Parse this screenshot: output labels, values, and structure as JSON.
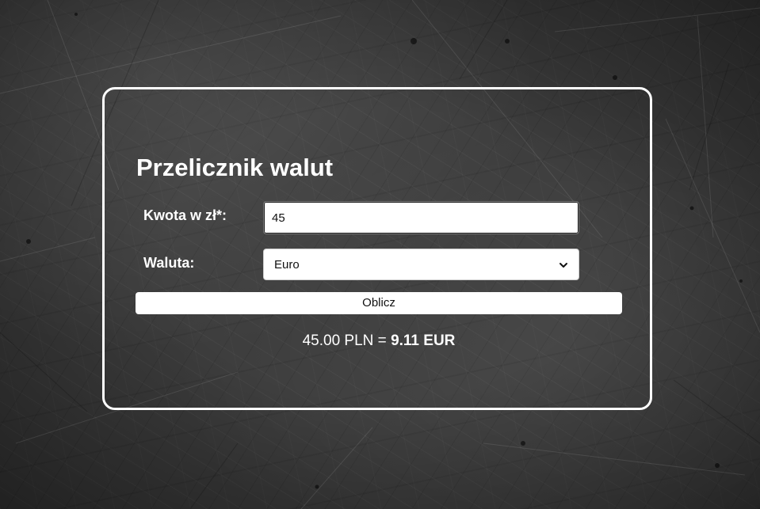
{
  "converter": {
    "title": "Przelicznik walut",
    "amount_label": "Kwota w zł*:",
    "amount_value": "45",
    "currency_label": "Waluta:",
    "currency_selected": "Euro",
    "calculate_label": "Oblicz",
    "result": {
      "source": "45.00 PLN",
      "equals": "=",
      "target": "9.11 EUR"
    }
  },
  "icons": {
    "select_arrow": "chevron-down-icon"
  },
  "colors": {
    "background": "#3c3c3c",
    "card_border": "#ffffff",
    "text": "#ffffff",
    "control_bg": "#ffffff"
  }
}
